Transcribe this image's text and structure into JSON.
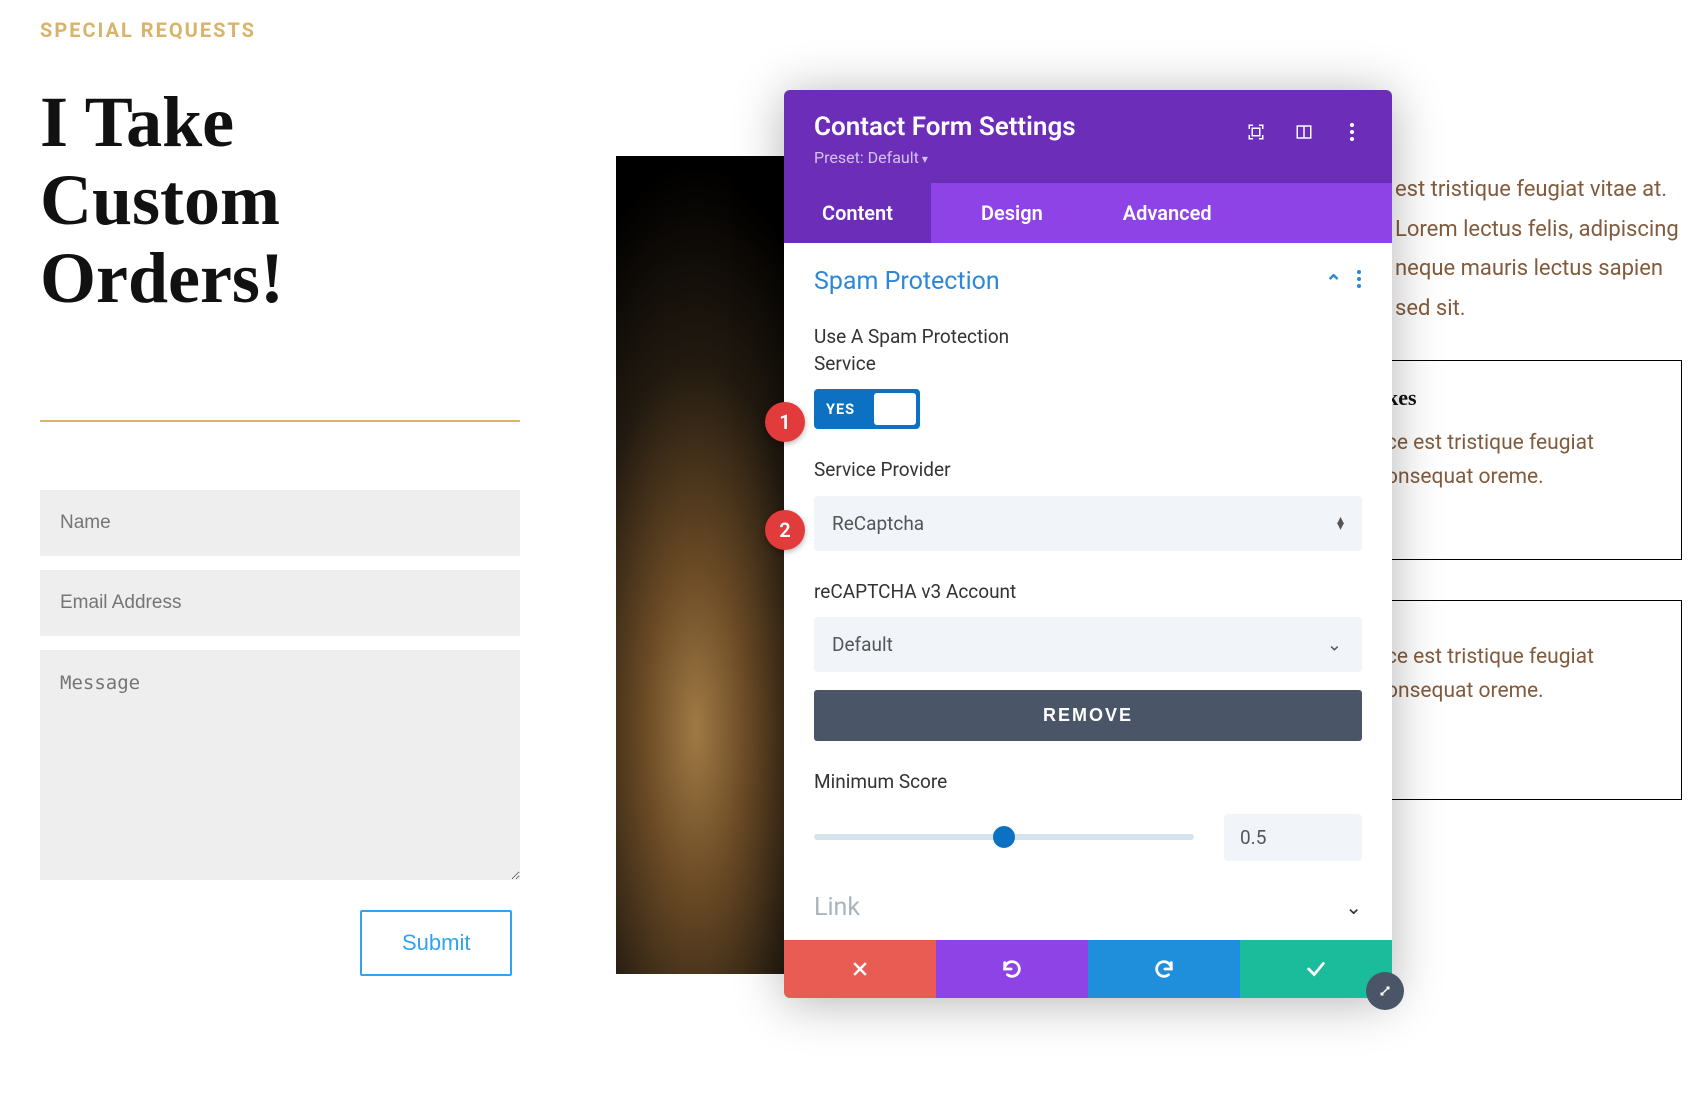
{
  "eyebrow": "SPECIAL REQUESTS",
  "hero_title": "I Take\nCustom\nOrders!",
  "form": {
    "name_placeholder": "Name",
    "email_placeholder": "Email Address",
    "message_placeholder": "Message",
    "submit_label": "Submit"
  },
  "right_paragraph": "est tristique feugiat vitae at. Lorem lectus felis, adipiscing neque mauris lectus sapien sed sit.",
  "card1": {
    "title": "akes",
    "body": "sce est tristique feugiat consequat oreme."
  },
  "card2": {
    "title": "",
    "body": "sce est tristique feugiat consequat oreme."
  },
  "modal": {
    "title": "Contact Form Settings",
    "preset_label": "Preset: Default",
    "tabs": {
      "content": "Content",
      "design": "Design",
      "advanced": "Advanced"
    },
    "section_title": "Spam Protection",
    "fields": {
      "use_spam_label": "Use A Spam Protection Service",
      "toggle_on_label": "YES",
      "provider_label": "Service Provider",
      "provider_value": "ReCaptcha",
      "account_label": "reCAPTCHA v3 Account",
      "account_value": "Default",
      "remove_label": "REMOVE",
      "min_score_label": "Minimum Score",
      "min_score_value": "0.5"
    },
    "link_section_title": "Link"
  },
  "callouts": {
    "one": "1",
    "two": "2"
  }
}
